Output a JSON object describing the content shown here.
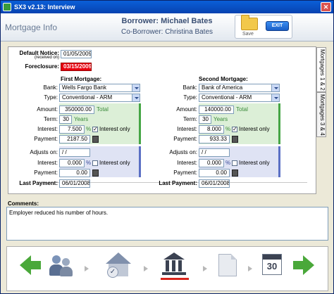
{
  "window": {
    "title": "SX3 v2.13: Interview",
    "close_glyph": "✕"
  },
  "header": {
    "page_title": "Mortgage Info",
    "borrower": "Borrower: Michael Bates",
    "co_borrower": "Co-Borrower: Christina Bates",
    "save_label": "Save",
    "exit_label": "EXIT"
  },
  "form": {
    "default_notice_label": "Default Notice:",
    "default_notice_sub": "(received on)",
    "default_notice_value": "01/05/2009",
    "foreclosure_label": "Foreclosure:",
    "foreclosure_value": "03/15/2009",
    "first": {
      "heading": "First Mortgage:",
      "bank_label": "Bank:",
      "bank": "Wells Fargo Bank",
      "type_label": "Type:",
      "type": "Conventional - ARM",
      "amount_label": "Amount:",
      "amount": "350000.00",
      "total": "Total",
      "term_label": "Term:",
      "term": "30",
      "years": "Years",
      "interest_label": "Interest:",
      "interest": "7.500",
      "pct": "%",
      "interest_only_label": "Interest only",
      "interest_only_checked": "✓",
      "payment_label": "Payment:",
      "payment": "2187.50",
      "adjusts_label": "Adjusts on:",
      "adjusts": " / /",
      "adj_interest_label": "Interest:",
      "adj_interest": "0.000",
      "adj_pct": "%",
      "adj_interest_only_label": "Interest only",
      "adj_payment_label": "Payment:",
      "adj_payment": "0.00",
      "last_payment_label": "Last Payment:",
      "last_payment": "06/01/2008"
    },
    "second": {
      "heading": "Second Mortgage:",
      "bank_label": "Bank:",
      "bank": "Bank of America",
      "type_label": "Type:",
      "type": "Conventional - ARM",
      "amount_label": "Amount:",
      "amount": "140000.00",
      "total": "Total",
      "term_label": "Term:",
      "term": "30",
      "years": "Years",
      "interest_label": "Interest:",
      "interest": "8.000",
      "pct": "%",
      "interest_only_label": "Interest only",
      "interest_only_checked": "✓",
      "payment_label": "Payment:",
      "payment": "933.33",
      "adjusts_label": "Adjusts on:",
      "adjusts": " / /",
      "adj_interest_label": "Interest:",
      "adj_interest": "0.000",
      "adj_pct": "%",
      "adj_interest_only_label": "Interest only",
      "adj_payment_label": "Payment:",
      "adj_payment": "0.00",
      "last_payment_label": "Last Payment:",
      "last_payment": "06/01/2008"
    },
    "tabs": [
      "Mortgages 1 & 2",
      "Mortgages 3 & 4"
    ]
  },
  "comments": {
    "label": "Comments:",
    "text": "Employer reduced his number of hours."
  },
  "nav": {
    "calendar_day": "30"
  },
  "colors": {
    "accent": "#0a5fd8",
    "alert": "#e8000e",
    "green": "#45a545",
    "blue": "#5a6fc4"
  }
}
